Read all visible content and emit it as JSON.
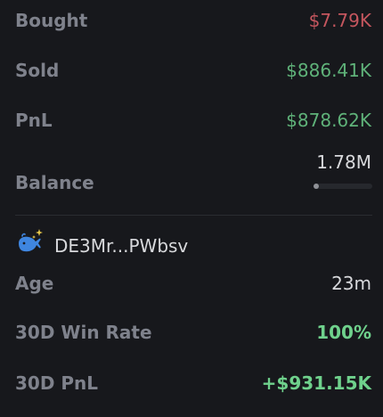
{
  "trade": {
    "bought_label": "Bought",
    "bought_value": "$7.79K",
    "sold_label": "Sold",
    "sold_value": "$886.41K",
    "pnl_label": "PnL",
    "pnl_value": "$878.62K",
    "balance_label": "Balance",
    "balance_value": "1.78M",
    "balance_fraction": 0.02
  },
  "trader": {
    "icon": "sparkle-whale-icon",
    "wallet": "DE3Mr...PWbsv",
    "age_label": "Age",
    "age_value": "23m",
    "win_rate_label": "30D Win Rate",
    "win_rate_value": "100%",
    "pnl30_label": "30D PnL",
    "pnl30_value": "+$931.15K"
  },
  "colors": {
    "background": "#17181c",
    "negative": "#c4565e",
    "positive": "#5fb279",
    "positive_strong": "#6fd18c",
    "whale": "#3f86e0",
    "sparkle": "#e8c84a"
  }
}
